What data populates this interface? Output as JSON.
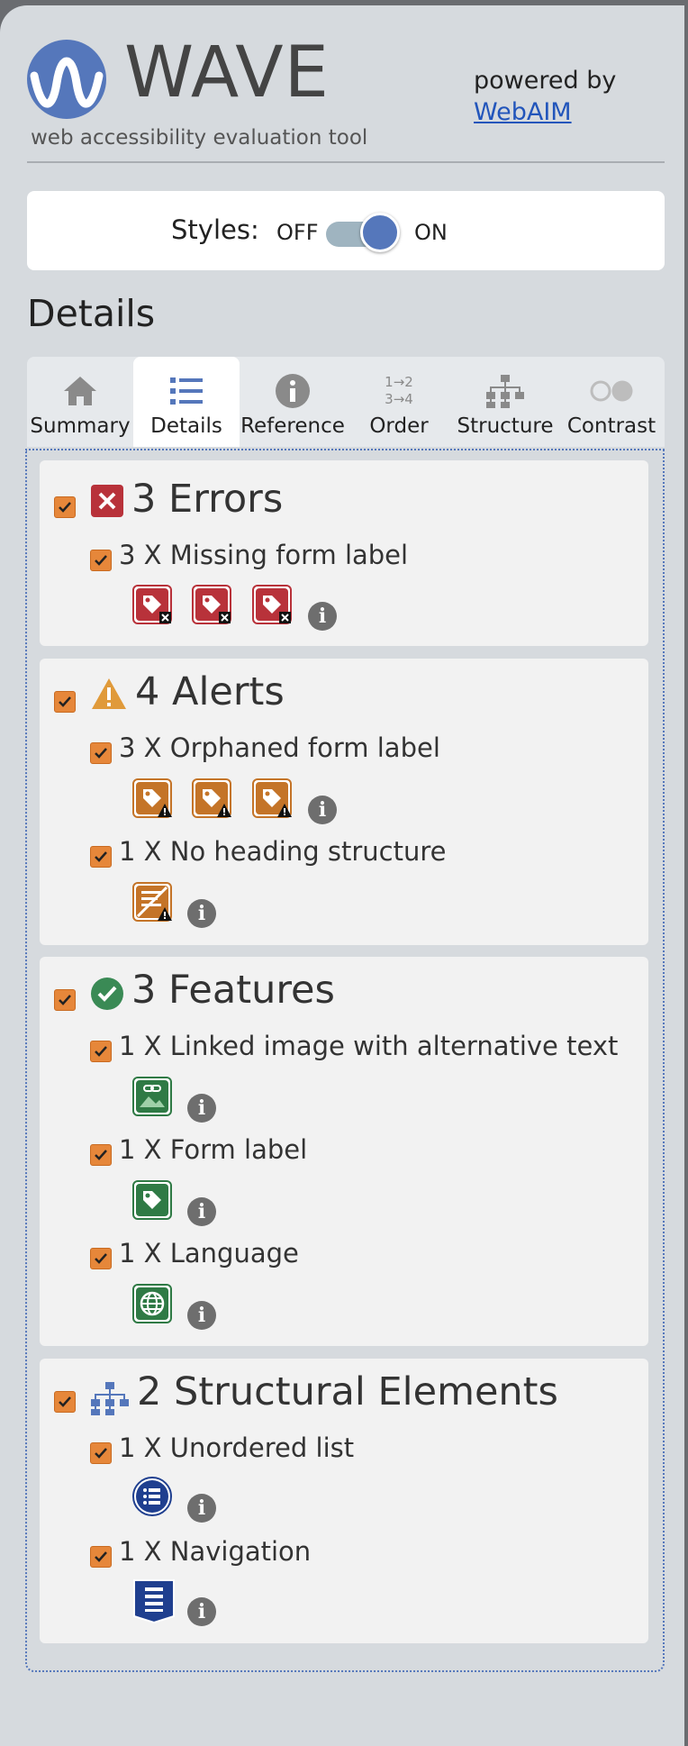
{
  "header": {
    "logo_word": "WAVE",
    "tagline": "web accessibility evaluation tool",
    "powered_by": "powered by",
    "webaim_link": "WebAIM"
  },
  "styles_toggle": {
    "label": "Styles:",
    "off": "OFF",
    "on": "ON",
    "state": "on"
  },
  "section_title": "Details",
  "tabs": [
    {
      "label": "Summary",
      "icon": "home-icon"
    },
    {
      "label": "Details",
      "icon": "list-icon",
      "active": true
    },
    {
      "label": "Reference",
      "icon": "info-icon"
    },
    {
      "label": "Order",
      "icon": "order-icon",
      "icon_text": [
        "1→2",
        "3→4"
      ]
    },
    {
      "label": "Structure",
      "icon": "structure-icon"
    },
    {
      "label": "Contrast",
      "icon": "contrast-icon"
    }
  ],
  "groups": {
    "errors": {
      "title": "3 Errors",
      "items": [
        {
          "label": "3 X Missing form label"
        }
      ]
    },
    "alerts": {
      "title": "4 Alerts",
      "items": [
        {
          "label": "3 X Orphaned form label"
        },
        {
          "label": "1 X No heading structure"
        }
      ]
    },
    "features": {
      "title": "3 Features",
      "items": [
        {
          "label": "1 X Linked image with alternative text"
        },
        {
          "label": "1 X Form label"
        },
        {
          "label": "1 X Language"
        }
      ]
    },
    "structural": {
      "title": "2 Structural Elements",
      "items": [
        {
          "label": "1 X Unordered list"
        },
        {
          "label": "1 X Navigation"
        }
      ]
    }
  },
  "colors": {
    "brand_blue": "#5577bb",
    "error_red": "#b8323a",
    "alert_orange": "#c47428",
    "feature_green": "#2f7a45",
    "structure_navy": "#1f3f8f",
    "checkbox_orange": "#e6873a"
  },
  "info_glyph": "i"
}
